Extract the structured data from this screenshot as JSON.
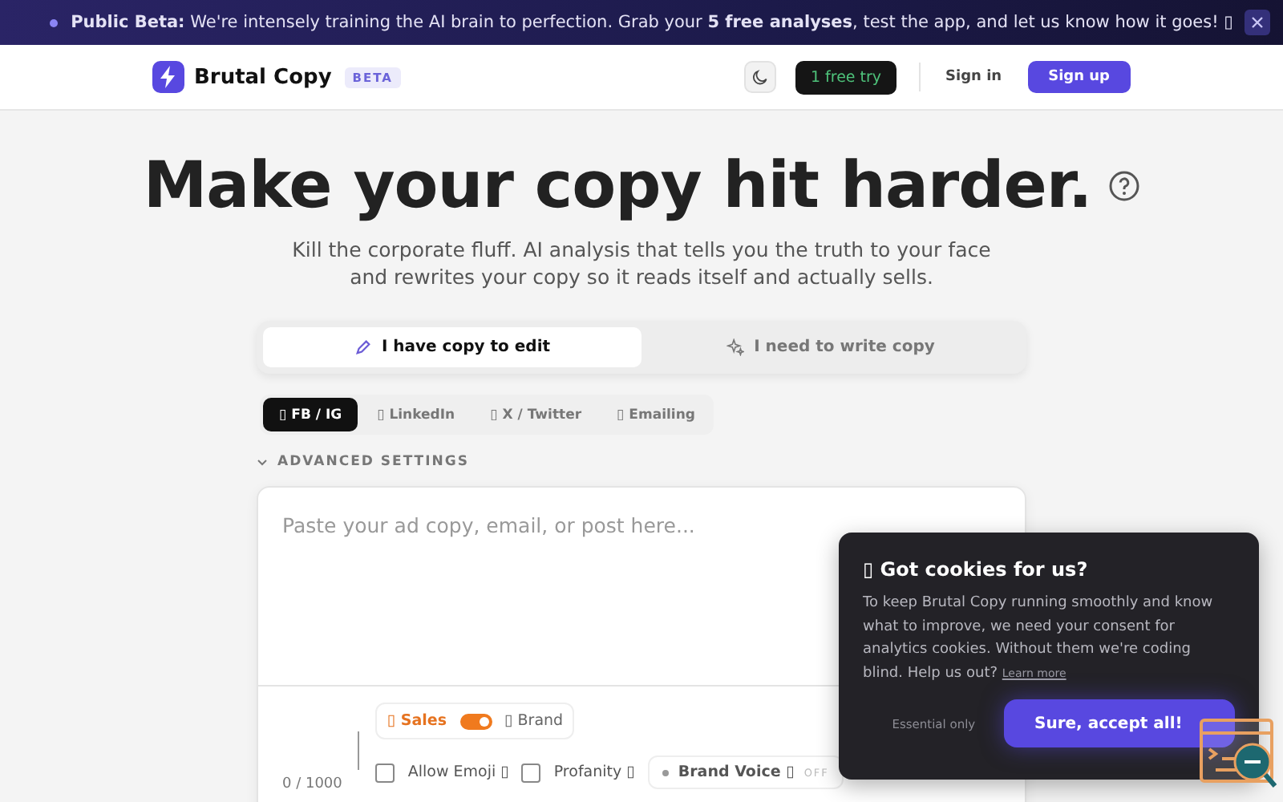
{
  "banner": {
    "text": "**Public Beta:** We're intensely training the AI brain to perfection. Grab your **5 free analyses**, test the app, and let us know how it goes! ▯"
  },
  "header": {
    "brand": "Brutal Copy",
    "badge": "BETA",
    "free_try": "1 free try",
    "sign_in": "Sign in",
    "sign_up": "Sign up"
  },
  "hero": {
    "title": "Make your copy hit harder.",
    "subtitle": "Kill the corporate fluff. AI analysis that tells you the truth to your face and rewrites your copy so it reads itself and actually sells."
  },
  "mode_tabs": [
    {
      "label": "I have copy to edit",
      "selected": true
    },
    {
      "label": "I need to write copy",
      "selected": false
    }
  ],
  "platform_tabs": [
    {
      "label": "▯ FB / IG",
      "selected": true
    },
    {
      "label": "▯ LinkedIn",
      "selected": false
    },
    {
      "label": "▯ X / Twitter",
      "selected": false
    },
    {
      "label": "▯ Emailing",
      "selected": false
    }
  ],
  "advanced_settings": {
    "label": "ADVANCED SETTINGS",
    "expanded": false
  },
  "editor": {
    "placeholder": "Paste your ad copy, email, or post here...",
    "counter": "0 / 1000",
    "tone": [
      {
        "label": "▯ Sales",
        "selected": true
      },
      {
        "label": "▯ Brand",
        "selected": false
      }
    ],
    "options": [
      {
        "kind": "checkbox",
        "label": "Allow Emoji ▯",
        "checked": false
      },
      {
        "kind": "checkbox",
        "label": "Profanity ▯",
        "checked": false
      },
      {
        "kind": "switch",
        "label": "Brand Voice ▯",
        "on": false,
        "state_text": "OFF"
      }
    ]
  },
  "cookie": {
    "title": "▯ Got cookies for us?",
    "body": "To keep Brutal Copy running smoothly and know what to improve, we need your consent for analytics cookies. Without them we're coding blind. Help us out?",
    "link": "Learn more",
    "decline": "Essential only",
    "accept": "Sure, accept all!"
  }
}
